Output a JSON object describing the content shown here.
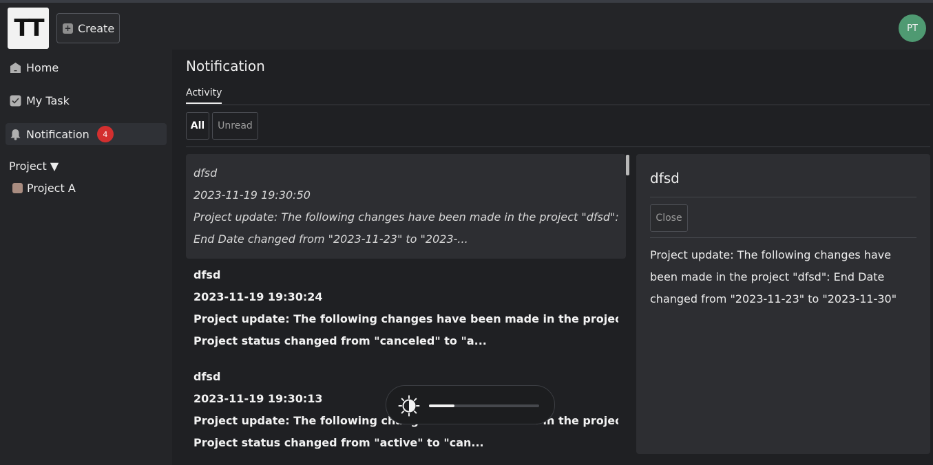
{
  "header": {
    "logo_text": "TT",
    "create_label": "Create",
    "avatar_initials": "PT"
  },
  "sidebar": {
    "items": [
      {
        "label": "Home",
        "icon": "home-icon"
      },
      {
        "label": "My Task",
        "icon": "check-icon"
      },
      {
        "label": "Notification",
        "icon": "bell-icon",
        "badge": "4"
      }
    ],
    "project_header": "Project ▼",
    "projects": [
      {
        "label": "Project A",
        "color": "#a98c80"
      }
    ]
  },
  "main": {
    "title": "Notification",
    "tab": "Activity",
    "filters": {
      "all": "All",
      "unread": "Unread"
    },
    "notifications": [
      {
        "title": "dfsd",
        "time": "2023-11-19 19:30:50",
        "line1": "Project update: The following changes have been made in the project \"dfsd\":",
        "line2": "End Date changed from \"2023-11-23\" to \"2023-...",
        "read": true
      },
      {
        "title": "dfsd",
        "time": "2023-11-19 19:30:24",
        "line1": "Project update: The following changes have been made in the project \"dfsd\":",
        "line2": "Project status changed from \"canceled\" to \"a...",
        "read": false
      },
      {
        "title": "dfsd",
        "time": "2023-11-19 19:30:13",
        "line1": "Project update: The following changes have been made in the project \"dfsd\":",
        "line2": "Project status changed from \"active\" to \"can...",
        "read": false
      }
    ]
  },
  "detail": {
    "title": "dfsd",
    "close_label": "Close",
    "body": "Project update: The following changes have been made in the project \"dfsd\": End Date changed from \"2023-11-23\" to \"2023-11-30\""
  },
  "brightness_overlay": {
    "icon": "brightness-icon",
    "level_fraction": 0.23
  },
  "colors": {
    "badge": "#d32f2f",
    "avatar": "#4f9a72"
  }
}
